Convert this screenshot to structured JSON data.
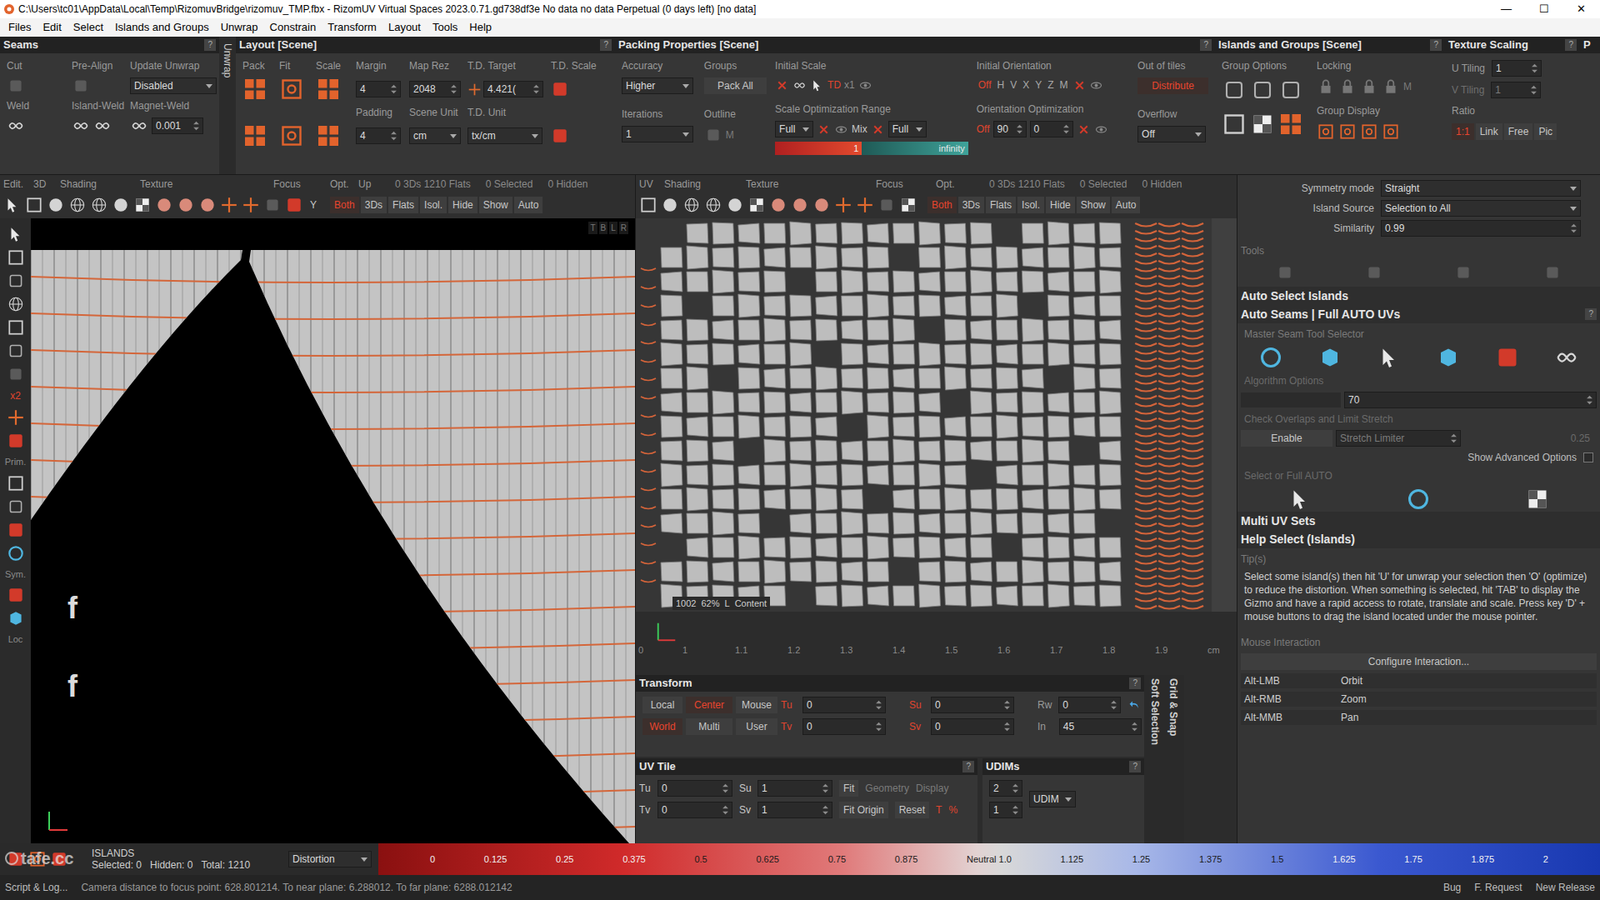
{
  "window": {
    "title": "C:\\Users\\tc01\\AppData\\Local\\Temp\\RizomuvBridge\\rizomuv_TMP.fbx - RizomUV  Virtual Spaces 2023.0.71.gd738df3e No data no data Perpetual  (0 days left) [no data]",
    "controls": [
      "—",
      "☐",
      "✕"
    ]
  },
  "menu": [
    "Files",
    "Edit",
    "Select",
    "Islands and Groups",
    "Unwrap",
    "Constrain",
    "Transform",
    "Layout",
    "Tools",
    "Help"
  ],
  "seams": {
    "title": "Seams",
    "help": "?",
    "side_tab": "Unwrap",
    "cut": "Cut",
    "pre_align": "Pre-Align",
    "update_unwrap": "Update Unwrap",
    "update_value": "Disabled",
    "weld": "Weld",
    "island_weld": "Island-Weld",
    "magnet_weld": "Magnet-Weld",
    "magnet_value": "0.001"
  },
  "layout": {
    "title": "Layout [Scene]",
    "help": "?",
    "columns": [
      "Pack",
      "Fit",
      "Scale",
      "Margin",
      "Map Rez",
      "T.D. Target",
      "T.D. Scale"
    ],
    "margin": "4",
    "map_rez": "2048",
    "td_target": "4.421(",
    "padding_label": "Padding",
    "padding": "4",
    "scene_unit_label": "Scene Unit",
    "scene_unit": "cm",
    "td_unit_label": "T.D. Unit",
    "td_unit": "tx/cm"
  },
  "packing": {
    "title": "Packing Properties [Scene]",
    "help": "?",
    "accuracy_label": "Accuracy",
    "accuracy": "Higher",
    "groups_label": "Groups",
    "groups": "Pack All",
    "initial_scale_label": "Initial Scale",
    "td_mark": "TD",
    "initial_scale": "x1",
    "iterations_label": "Iterations",
    "iterations": "1",
    "outline_label": "Outline",
    "outline": "M",
    "scale_range_label": "Scale Optimization Range",
    "scale_min": "Full",
    "mix": "Mix",
    "scale_max": "Full",
    "range_low": "1",
    "range_high": "infinity",
    "range_level": 0.45,
    "orientation_label": "Initial Orientation",
    "orientation": [
      {
        "label": "Off",
        "selected": true
      },
      {
        "label": "H",
        "selected": false
      },
      {
        "label": "V",
        "selected": false
      },
      {
        "label": "X",
        "selected": false
      },
      {
        "label": "Y",
        "selected": false
      },
      {
        "label": "Z",
        "selected": false
      },
      {
        "label": "M",
        "selected": false
      }
    ],
    "out_of_tiles_label": "Out of tiles",
    "distribute": "Distribute",
    "orient_opt_label": "Orientation Optimization",
    "orient_opt": "Off",
    "orient_step": "90",
    "orient_value": "0",
    "overflow_label": "Overflow",
    "overflow": "Off"
  },
  "islands_groups": {
    "title": "Islands and Groups [Scene]",
    "help": "?",
    "group_options": "Group Options",
    "locking": "Locking",
    "group_display": "Group Display",
    "m": "M"
  },
  "texture_scaling": {
    "title": "Texture Scaling",
    "help": "?",
    "u_label": "U Tiling",
    "u": "1",
    "v_label": "V Tiling",
    "v": "1",
    "ratio_label": "Ratio",
    "ratio_buttons": [
      {
        "label": "1:1",
        "selected": true
      },
      {
        "label": "Link",
        "selected": false
      },
      {
        "label": "Free",
        "selected": false
      },
      {
        "label": "Pic",
        "selected": false
      }
    ]
  },
  "extra_panel": {
    "title": "P"
  },
  "tool_strip": {
    "labels": [
      "x2",
      "Prim.",
      "Sym.",
      "Loc"
    ]
  },
  "view3d": {
    "labels": [
      "Edit.",
      "3D",
      "Shading",
      "Texture",
      "Focus",
      "Opt.",
      "Up"
    ],
    "up_axis": "Y",
    "stats": [
      "0 3Ds 1210 Flats",
      "0 Selected",
      "0 Hidden"
    ],
    "buttons": [
      {
        "label": "Both",
        "selected": true
      },
      {
        "label": "3Ds",
        "selected": false
      },
      {
        "label": "Flats",
        "selected": false
      },
      {
        "label": "Isol.",
        "selected": false
      },
      {
        "label": "Hide",
        "selected": false
      },
      {
        "label": "Show",
        "selected": false
      },
      {
        "label": "Auto",
        "selected": false
      }
    ],
    "cam_letters": [
      "T",
      "B",
      "L",
      "R"
    ],
    "markers": [
      "f",
      "f"
    ]
  },
  "viewuv": {
    "labels": [
      "UV",
      "Shading",
      "Texture",
      "Focus",
      "Opt."
    ],
    "stats": [
      "0 3Ds 1210 Flats",
      "0 Selected",
      "0 Hidden"
    ],
    "buttons": [
      {
        "label": "Both",
        "selected": true
      },
      {
        "label": "3Ds",
        "selected": false
      },
      {
        "label": "Flats",
        "selected": false
      },
      {
        "label": "Isol.",
        "selected": false
      },
      {
        "label": "Hide",
        "selected": false
      },
      {
        "label": "Show",
        "selected": false
      },
      {
        "label": "Auto",
        "selected": false
      }
    ],
    "tile_info": [
      "1002",
      "62%",
      "L",
      "Content"
    ],
    "ruler": [
      "0",
      "1",
      "1.1",
      "1.2",
      "1.3",
      "1.4",
      "1.5",
      "1.6",
      "1.7",
      "1.8",
      "1.9"
    ],
    "ruler_unit": "cm"
  },
  "transform": {
    "title": "Transform",
    "help": "?",
    "row1": [
      {
        "label": "Local",
        "selected": false
      },
      {
        "label": "Center",
        "selected": true
      },
      {
        "label": "Mouse",
        "selected": false
      }
    ],
    "row2": [
      {
        "label": "World",
        "selected": true
      },
      {
        "label": "Multi",
        "selected": false
      },
      {
        "label": "User",
        "selected": false
      }
    ],
    "fields1": [
      {
        "label": "Tu",
        "value": "0"
      },
      {
        "label": "Su",
        "value": "0"
      },
      {
        "label": "Rw",
        "value": "0"
      }
    ],
    "fields2": [
      {
        "label": "Tv",
        "value": "0"
      },
      {
        "label": "Sv",
        "value": "0"
      },
      {
        "label": "In",
        "value": "45"
      }
    ]
  },
  "side_tabs": [
    "Soft Selection",
    "Grid & Snap"
  ],
  "uv_tile": {
    "title": "UV Tile",
    "help": "?",
    "row1": [
      {
        "label": "Tu",
        "value": "0"
      },
      {
        "label": "Su",
        "value": "1"
      }
    ],
    "row2": [
      {
        "label": "Tv",
        "value": "0"
      },
      {
        "label": "Sv",
        "value": "1"
      }
    ],
    "fit": "Fit",
    "fit_origin": "Fit Origin",
    "geometry": "Geometry",
    "display": "Display",
    "reset": "Reset",
    "t": "T",
    "pct": "%"
  },
  "udims": {
    "title": "UDIMs",
    "help": "?",
    "values": [
      "2",
      "1"
    ],
    "mode": "UDIM"
  },
  "right_panel": {
    "help": "?",
    "rows": [
      {
        "label": "Symmetry mode",
        "value": "Straight"
      },
      {
        "label": "Island Source",
        "value": "Selection to All"
      },
      {
        "label": "Similarity",
        "value": "0.99"
      }
    ],
    "tools_label": "Tools",
    "sections": [
      "Auto Select Islands",
      "Auto Seams | Full AUTO UVs"
    ],
    "master_label": "Master Seam Tool Selector",
    "algorithm_label": "Algorithm Options",
    "algorithm_value": "70",
    "overlaps_label": "Check Overlaps and Limit Stretch",
    "enable": "Enable",
    "stretch_label": "Stretch Limiter",
    "stretch_value": "0.25",
    "advanced": "Show Advanced Options",
    "advanced_checked": false,
    "select_label": "Select or Full AUTO",
    "multi": "Multi UV Sets",
    "help_title": "Help Select (Islands)",
    "tips_label": "Tip(s)",
    "tip": "Select some island(s) then hit 'U' for unwrap your selection then 'O' (optimize) to reduce the distortion. When something is selected, hit 'TAB' to display the Gizmo and have a rapid access to rotate, translate and scale. Press key 'D' + mouse buttons to drag the island located under the mouse pointer.",
    "mouse_label": "Mouse Interaction",
    "configure": "Configure Interaction...",
    "bindings": [
      {
        "key": "Alt-LMB",
        "action": "Orbit"
      },
      {
        "key": "Alt-RMB",
        "action": "Zoom"
      },
      {
        "key": "Alt-MMB",
        "action": "Pan"
      }
    ]
  },
  "bottom": {
    "mode": "ISLANDS",
    "selected": "Selected: 0",
    "hidden": "Hidden: 0",
    "total": "Total: 1210",
    "display": "Distortion",
    "ticks": [
      "0",
      "0.125",
      "0.25",
      "0.375",
      "0.5",
      "0.625",
      "0.75",
      "0.875",
      "Neutral 1.0",
      "1.125",
      "1.25",
      "1.375",
      "1.5",
      "1.625",
      "1.75",
      "1.875",
      "2"
    ]
  },
  "status": {
    "script": "Script & Log...",
    "message": "Camera distance to focus point: 628.801214. To near plane: 6.288012. To far plane: 6288.012142",
    "buttons": [
      "Bug",
      "F. Request",
      "New Release"
    ],
    "watermark": "tafe.cc"
  }
}
